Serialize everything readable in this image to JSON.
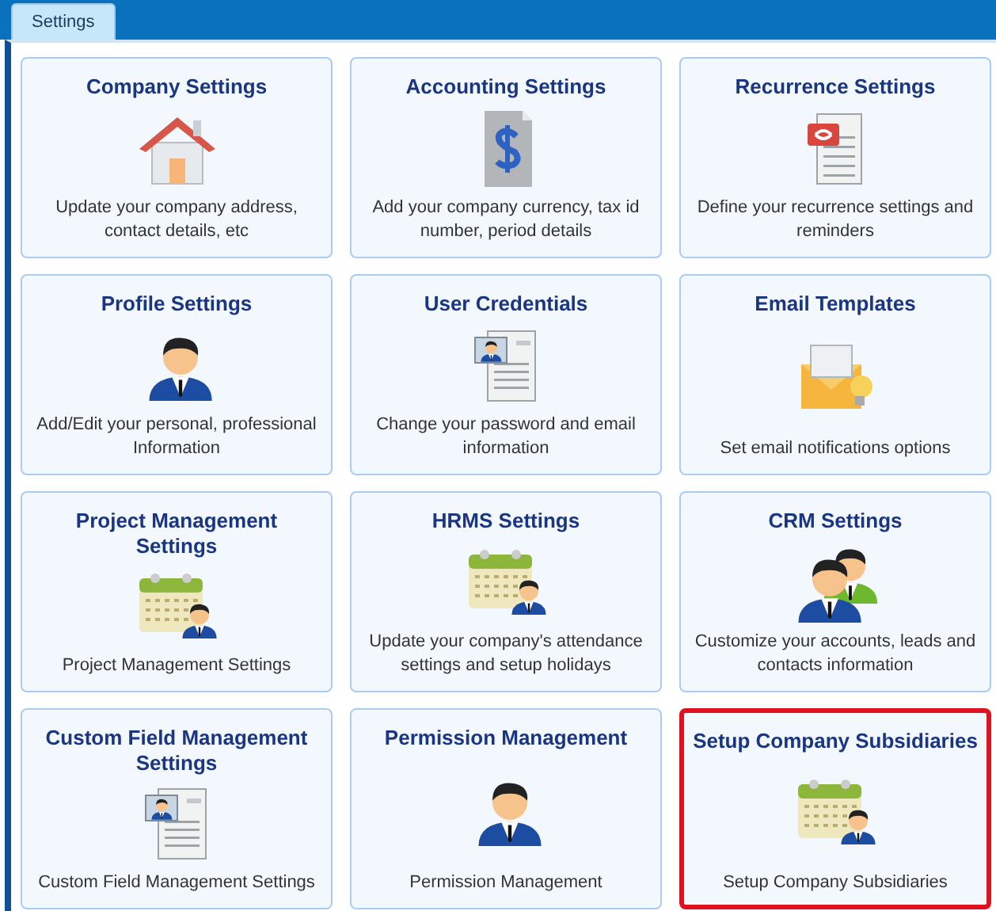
{
  "tabs": [
    {
      "label": "Settings",
      "selected": true
    }
  ],
  "cards": [
    {
      "title": "Company Settings",
      "kind": "house",
      "description": "Update your company address, contact details, etc",
      "highlighted": false
    },
    {
      "title": "Accounting Settings",
      "kind": "dollar",
      "description": "Add your company currency, tax id number, period details",
      "highlighted": false
    },
    {
      "title": "Recurrence Settings",
      "kind": "recurrence",
      "description": "Define your recurrence settings and reminders",
      "highlighted": false
    },
    {
      "title": "Profile Settings",
      "kind": "person",
      "description": "Add/Edit your personal, professional Information",
      "highlighted": false
    },
    {
      "title": "User Credentials",
      "kind": "idcard",
      "description": "Change your password and email information",
      "highlighted": false
    },
    {
      "title": "Email Templates",
      "kind": "email",
      "description": "Set email notifications options",
      "highlighted": false
    },
    {
      "title": "Project Management Settings",
      "kind": "calendar",
      "description": "Project Management Settings",
      "highlighted": false
    },
    {
      "title": "HRMS Settings",
      "kind": "calendar",
      "description": "Update your company's attendance settings and setup holidays",
      "highlighted": false
    },
    {
      "title": "CRM Settings",
      "kind": "people",
      "description": "Customize your accounts, leads and contacts information",
      "highlighted": false
    },
    {
      "title": "Custom Field Management Settings",
      "kind": "idcard",
      "description": "Custom Field Management Settings",
      "highlighted": false
    },
    {
      "title": "Permission Management",
      "kind": "person",
      "description": "Permission Management",
      "highlighted": false
    },
    {
      "title": "Setup Company Subsidiaries",
      "kind": "calendar",
      "description": "Setup Company Subsidiaries",
      "highlighted": true
    }
  ]
}
